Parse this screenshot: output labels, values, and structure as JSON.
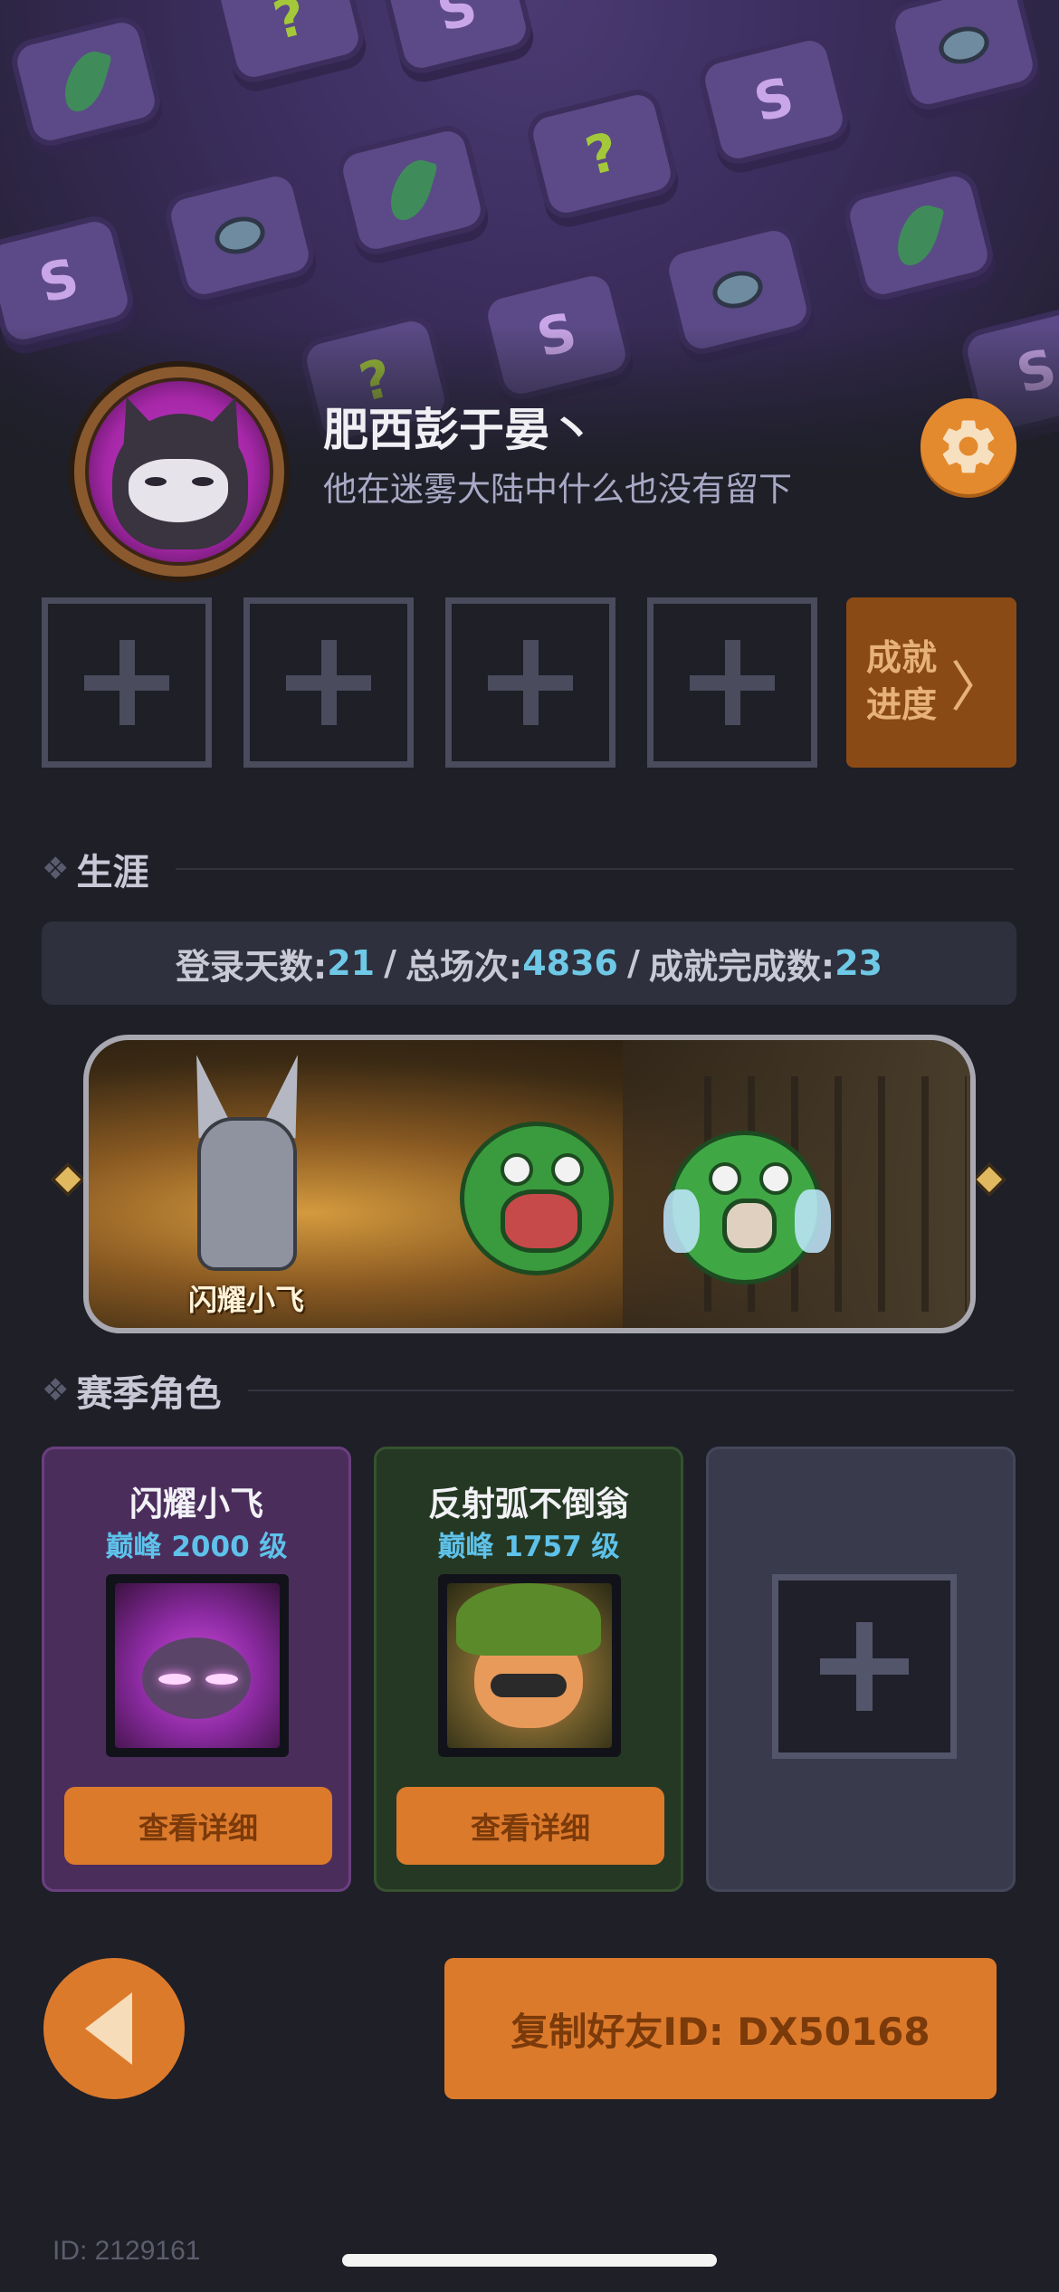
{
  "profile": {
    "username": "肥西彭于晏丶",
    "bio": "他在迷雾大陆中什么也没有留下",
    "avatar_icon": "hooded-raccoon-avatar",
    "settings_icon": "gear-icon"
  },
  "achievements": {
    "slots": [
      {
        "icon": "plus-icon"
      },
      {
        "icon": "plus-icon"
      },
      {
        "icon": "plus-icon"
      },
      {
        "icon": "plus-icon"
      }
    ],
    "progress_label_line1": "成就",
    "progress_label_line2": "进度",
    "progress_chevron": "〉"
  },
  "career": {
    "title": "生涯",
    "login_days_label": "登录天数:",
    "login_days": "21",
    "total_matches_label": "总场次:",
    "total_matches": "4836",
    "achievements_done_label": "成就完成数:",
    "achievements_done": "23",
    "separator": "/"
  },
  "showcase": {
    "hero_label": "闪耀小飞"
  },
  "season": {
    "title": "赛季角色",
    "roles": [
      {
        "name": "闪耀小飞",
        "rank": "巅峰 2000 级",
        "button": "查看详细"
      },
      {
        "name": "反射弧不倒翁",
        "rank": "巅峰 1757 级",
        "button": "查看详细"
      }
    ],
    "empty_slot_icon": "plus-icon"
  },
  "bottom": {
    "back_icon": "back-arrow-icon",
    "copy_label": "复制好友ID: DX50168",
    "footer_id": "ID: 2129161"
  },
  "colors": {
    "accent_orange": "#dc7a2c",
    "stat_value_blue": "#6ec8e6",
    "rank_blue": "#5ec2ea",
    "background": "#1e1f27"
  }
}
